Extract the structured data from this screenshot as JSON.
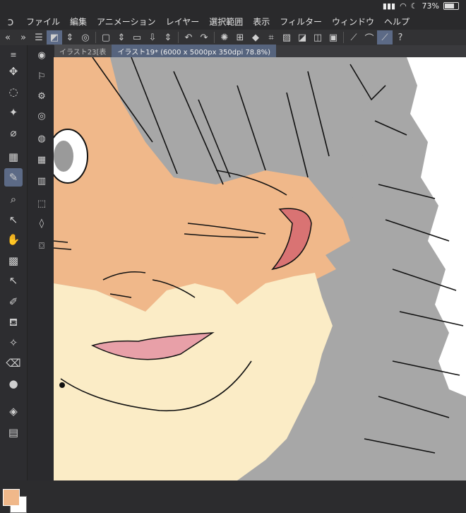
{
  "status": {
    "battery": "73%"
  },
  "menu": [
    "ファイル",
    "編集",
    "アニメーション",
    "レイヤー",
    "選択範囲",
    "表示",
    "フィルター",
    "ウィンドウ",
    "ヘルプ"
  ],
  "tabs": [
    {
      "label": "イラスト23[表"
    },
    {
      "label": "イラスト19* (6000 x 5000px 350dpi 78.8%)"
    }
  ],
  "colors": {
    "accent": "#5c6a86",
    "skin": "#f0b88a",
    "beard": "#fbecc6",
    "fur": "#a7a7a7",
    "mouth": "#e8a0a8"
  }
}
